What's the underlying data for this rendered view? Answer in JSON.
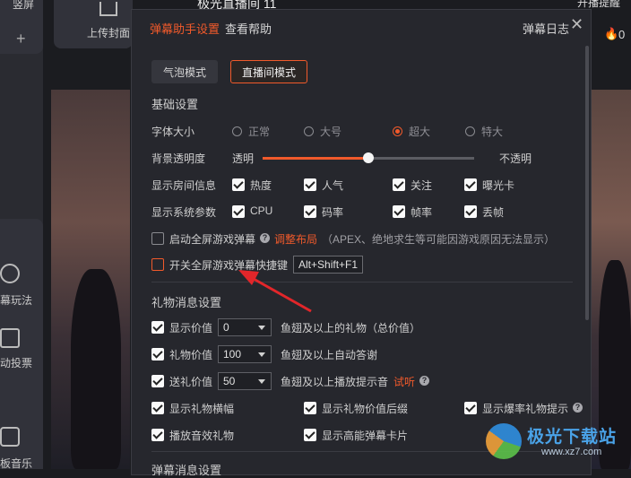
{
  "background": {
    "left_top_label": "竖屏",
    "left_plus": "+",
    "upload_label": "上传封面",
    "stream_title": "极光直播间 11",
    "top_right_label": "开播提醒",
    "top_right_count": "0",
    "left_items": [
      "幕玩法",
      "动投票",
      "板音乐"
    ]
  },
  "dialog": {
    "tabs": [
      {
        "label": "弹幕助手设置",
        "active": true
      },
      {
        "label": "查看帮助",
        "active": false
      }
    ],
    "log_label": "弹幕日志",
    "close_label": "✕",
    "modes": [
      {
        "label": "气泡模式",
        "active": false
      },
      {
        "label": "直播间模式",
        "active": true
      }
    ],
    "basic": {
      "title": "基础设置",
      "font_size": {
        "label": "字体大小",
        "options": [
          "正常",
          "大号",
          "超大",
          "特大"
        ],
        "selected": "超大"
      },
      "opacity": {
        "label": "背景透明度",
        "min_label": "透明",
        "max_label": "不透明",
        "value_fraction": 0.5
      },
      "room_info": {
        "label": "显示房间信息",
        "items": [
          {
            "label": "热度",
            "checked": true
          },
          {
            "label": "人气",
            "checked": true
          },
          {
            "label": "关注",
            "checked": true
          },
          {
            "label": "曝光卡",
            "checked": true
          }
        ]
      },
      "system_params": {
        "label": "显示系统参数",
        "items": [
          {
            "label": "CPU",
            "checked": true
          },
          {
            "label": "码率",
            "checked": true
          },
          {
            "label": "帧率",
            "checked": true
          },
          {
            "label": "丢帧",
            "checked": true
          }
        ]
      },
      "fullscreen": {
        "label": "启动全屏游戏弹幕",
        "checked": false,
        "link": "调整布局",
        "hint": "（APEX、绝地求生等可能因游戏原因无法显示）"
      },
      "hotkey": {
        "label": "开关全屏游戏弹幕快捷键",
        "checked": false,
        "value": "Alt+Shift+F1"
      }
    },
    "gift": {
      "title": "礼物消息设置",
      "rows": [
        {
          "label": "显示价值",
          "checked": true,
          "value": "0",
          "suffix": "鱼翅及以上的礼物（总价值）"
        },
        {
          "label": "礼物价值",
          "checked": true,
          "value": "100",
          "suffix": "鱼翅及以上自动答谢"
        },
        {
          "label": "送礼价值",
          "checked": true,
          "value": "50",
          "suffix": "鱼翅及以上播放提示音",
          "link": "试听"
        }
      ],
      "options": [
        {
          "label": "显示礼物横幅",
          "checked": true
        },
        {
          "label": "显示礼物价值后缀",
          "checked": true
        },
        {
          "label": "显示爆率礼物提示",
          "checked": true
        },
        {
          "label": "播放音效礼物",
          "checked": true
        },
        {
          "label": "显示高能弹幕卡片",
          "checked": true
        }
      ]
    },
    "danmaku_title": "弹幕消息设置"
  },
  "watermark": {
    "main": "极光下载站",
    "sub": "www.xz7.com"
  },
  "colors": {
    "accent": "#f15a2b",
    "dialog_bg": "#26272d",
    "page_bg": "#1b1c20"
  }
}
